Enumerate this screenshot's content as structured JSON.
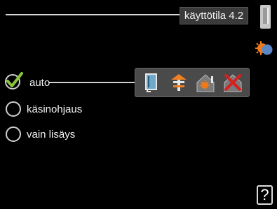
{
  "header": {
    "title": "käyttötila 4.2"
  },
  "options": [
    {
      "label": "auto",
      "selected": true
    },
    {
      "label": "käsinohjaus",
      "selected": false
    },
    {
      "label": "vain lisäys",
      "selected": false
    }
  ],
  "icons": {
    "menu": "menu-tab-icon",
    "season": "season-sun-icon",
    "panel": [
      "compressor-icon",
      "additional-heat-icon",
      "heating-icon",
      "heating-off-icon"
    ]
  },
  "help": {
    "label": "?"
  },
  "colors": {
    "background": "#000000",
    "accent_check": "#8cc63f",
    "heat_orange": "#f08020",
    "cross_red": "#d62020"
  }
}
